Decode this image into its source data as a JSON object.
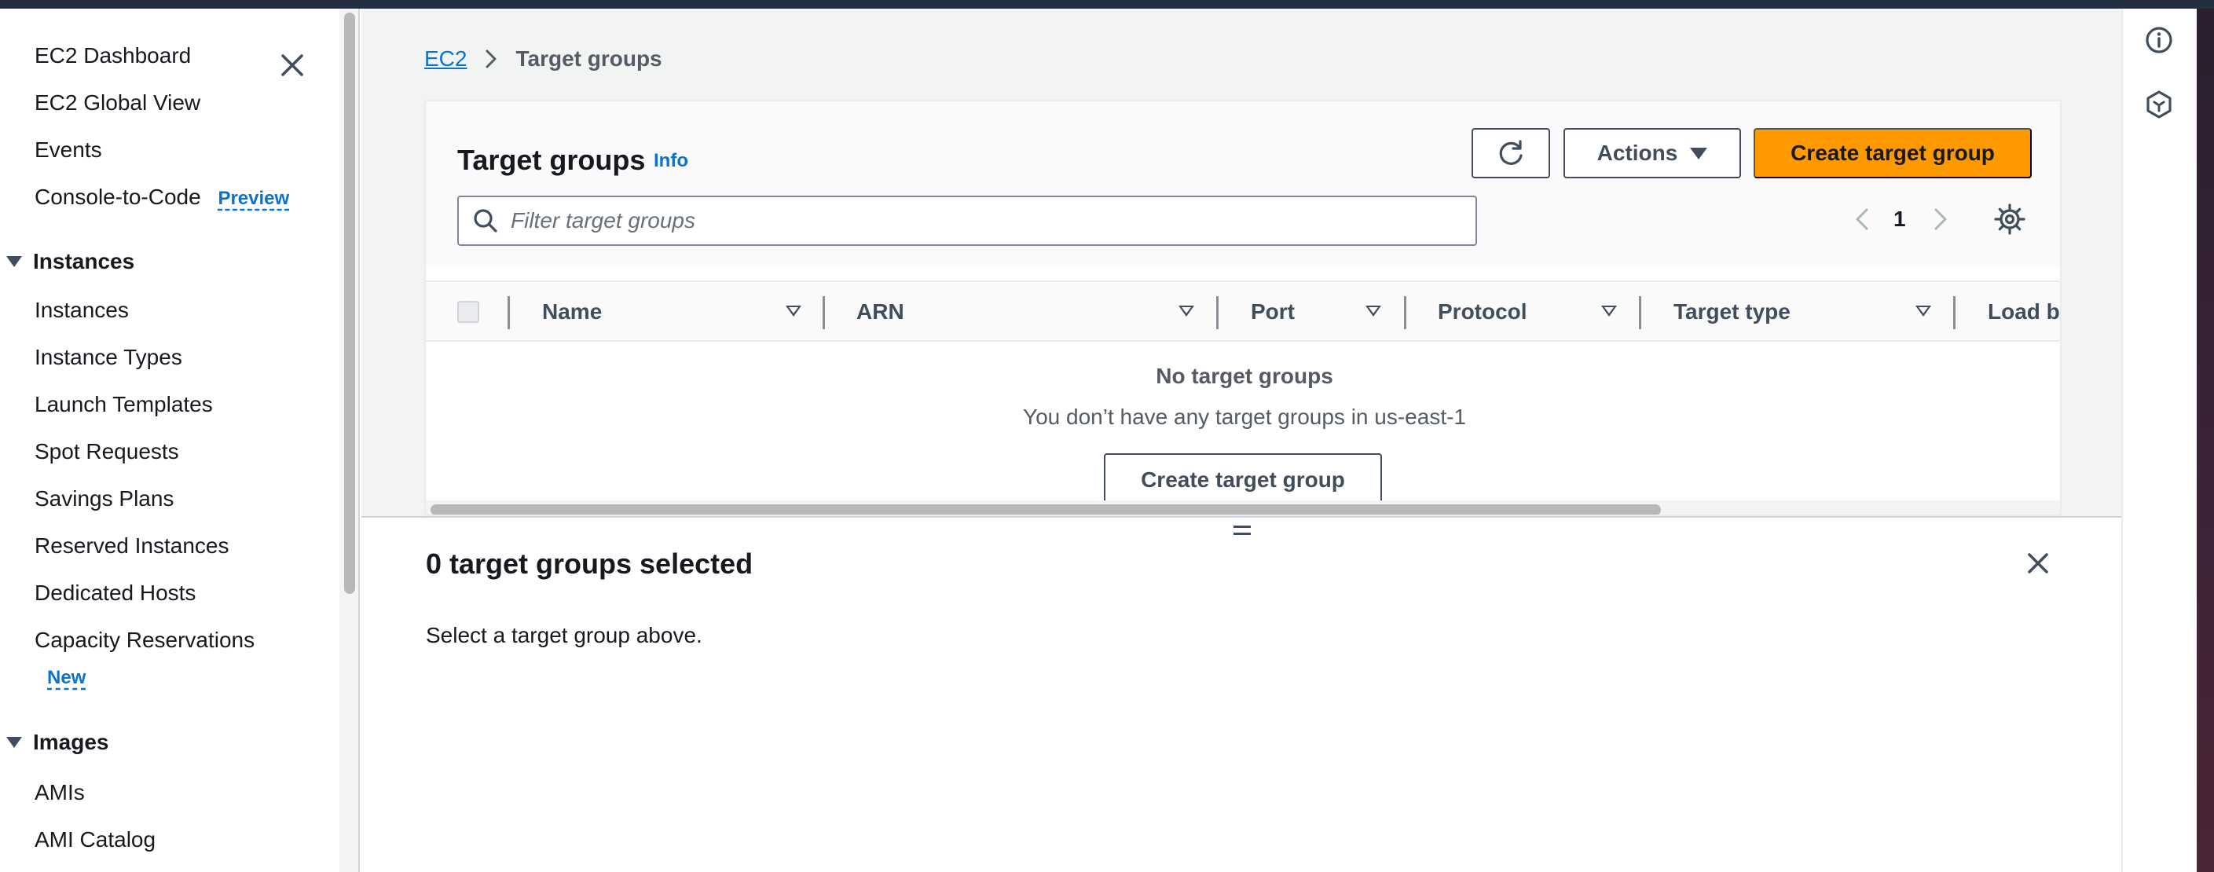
{
  "sidebar": {
    "items": [
      {
        "label": "EC2 Dashboard"
      },
      {
        "label": "EC2 Global View"
      },
      {
        "label": "Events"
      },
      {
        "label": "Console-to-Code",
        "badge": "Preview"
      }
    ],
    "sections": [
      {
        "title": "Instances",
        "items": [
          {
            "label": "Instances"
          },
          {
            "label": "Instance Types"
          },
          {
            "label": "Launch Templates"
          },
          {
            "label": "Spot Requests"
          },
          {
            "label": "Savings Plans"
          },
          {
            "label": "Reserved Instances"
          },
          {
            "label": "Dedicated Hosts"
          },
          {
            "label": "Capacity Reservations",
            "badge": "New"
          }
        ]
      },
      {
        "title": "Images",
        "items": [
          {
            "label": "AMIs"
          },
          {
            "label": "AMI Catalog"
          }
        ]
      }
    ]
  },
  "breadcrumb": {
    "root": "EC2",
    "current": "Target groups"
  },
  "panel": {
    "title": "Target groups",
    "info_label": "Info",
    "actions_label": "Actions",
    "create_label": "Create target group",
    "search_placeholder": "Filter target groups",
    "page_number": "1",
    "columns": [
      "Name",
      "ARN",
      "Port",
      "Protocol",
      "Target type",
      "Load ba"
    ],
    "empty_title": "No target groups",
    "empty_description": "You don’t have any target groups in us-east-1",
    "empty_create_label": "Create target group"
  },
  "split": {
    "title": "0 target groups selected",
    "description": "Select a target group above."
  },
  "icons": {
    "close": "close-icon",
    "refresh": "refresh-icon",
    "search": "search-icon",
    "settings": "settings-icon",
    "info": "info-circle-icon",
    "cloudshell": "hexagon-icon"
  },
  "colors": {
    "primary_button": "#ff9900",
    "link": "#0972d3",
    "nav_bar": "#232f3e"
  }
}
